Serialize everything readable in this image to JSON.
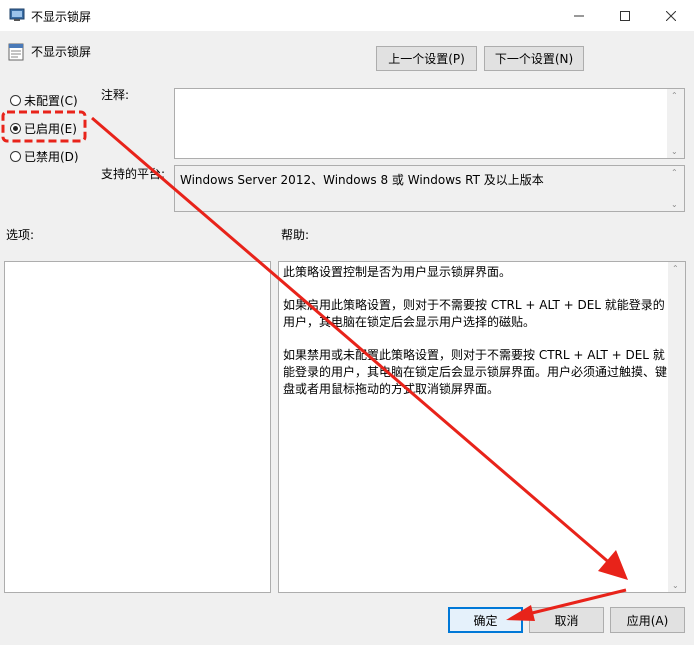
{
  "window": {
    "title": "不显示锁屏",
    "controls": [
      "minimize-icon",
      "maximize-icon",
      "close-icon"
    ]
  },
  "header": {
    "setting_name": "不显示锁屏",
    "prev_label": "上一个设置(P)",
    "next_label": "下一个设置(N)"
  },
  "state": {
    "options": [
      {
        "label": "未配置(C)",
        "checked": false
      },
      {
        "label": "已启用(E)",
        "checked": true
      },
      {
        "label": "已禁用(D)",
        "checked": false
      }
    ]
  },
  "comment": {
    "label": "注释:",
    "value": ""
  },
  "platform": {
    "label": "支持的平台:",
    "value": "Windows Server 2012、Windows 8 或 Windows RT 及以上版本"
  },
  "options_section": {
    "label": "选项:"
  },
  "help_section": {
    "label": "帮助:",
    "paragraphs": [
      "此策略设置控制是否为用户显示锁屏界面。",
      "如果启用此策略设置，则对于不需要按 CTRL + ALT + DEL 就能登录的用户，其电脑在锁定后会显示用户选择的磁贴。",
      "如果禁用或未配置此策略设置，则对于不需要按 CTRL + ALT + DEL 就能登录的用户，其电脑在锁定后会显示锁屏界面。用户必须通过触摸、键盘或者用鼠标拖动的方式取消锁屏界面。"
    ]
  },
  "footer": {
    "ok_label": "确定",
    "cancel_label": "取消",
    "apply_label": "应用(A)"
  },
  "colors": {
    "annotation_red": "#e8231a",
    "focus_blue": "#0078d7"
  }
}
